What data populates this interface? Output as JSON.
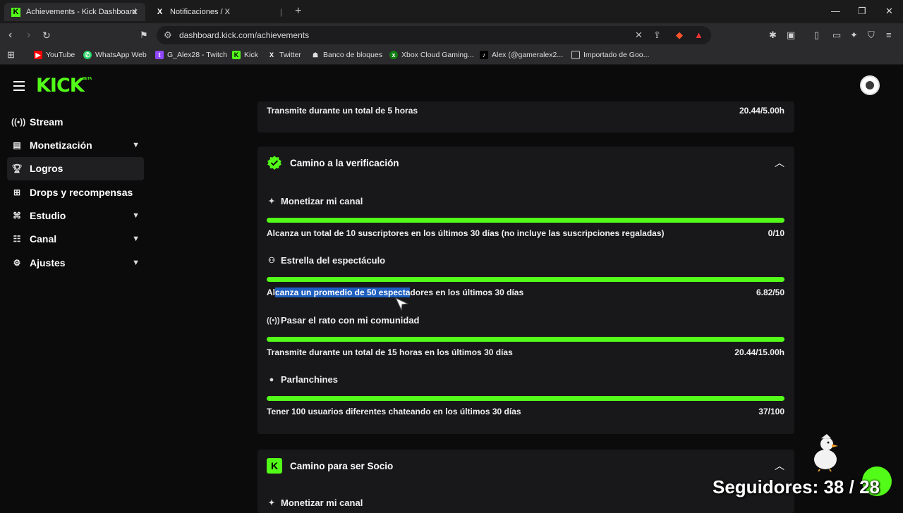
{
  "browser": {
    "tabs": [
      {
        "title": "Achievements - Kick Dashboard",
        "active": true
      },
      {
        "title": "Notificaciones / X",
        "active": false
      }
    ],
    "url": "dashboard.kick.com/achievements",
    "bookmarks": [
      "YouTube",
      "WhatsApp Web",
      "G_Alex28 - Twitch",
      "Kick",
      "Twitter",
      "Banco de bloques",
      "Xbox Cloud Gaming...",
      "Alex (@gameralex2...",
      "Importado de Goo..."
    ]
  },
  "header": {
    "logo": "KICK",
    "logo_badge": "BETA"
  },
  "sidebar": {
    "items": [
      {
        "label": "Stream",
        "icon": "broadcast-icon"
      },
      {
        "label": "Monetización",
        "icon": "chart-icon"
      },
      {
        "label": "Logros",
        "icon": "trophy-icon"
      },
      {
        "label": "Drops y recompensas",
        "icon": "gift-icon"
      },
      {
        "label": "Estudio",
        "icon": "studio-icon"
      },
      {
        "label": "Canal",
        "icon": "channel-icon"
      },
      {
        "label": "Ajustes",
        "icon": "gear-icon"
      }
    ]
  },
  "top_card": {
    "text": "Transmite durante un total de 5 horas",
    "value": "20.44/5.00h"
  },
  "verification": {
    "title": "Camino a la verificación",
    "achievements": [
      {
        "title": "Monetizar mi canal",
        "desc": "Alcanza un total de 10 suscriptores en los últimos 30 días (no incluye las suscripciones regaladas)",
        "value": "0/10",
        "progress": 1.0
      },
      {
        "title": "Estrella del espectáculo",
        "desc_pre": "Al",
        "desc_hl": "canza un promedio de 50 especta",
        "desc_post": "dores en los últimos 30 días",
        "value": "6.82/50",
        "progress": 1.0
      },
      {
        "title": "Pasar el rato con mi comunidad",
        "desc": "Transmite durante un total de 15 horas en los últimos 30 días",
        "value": "20.44/15.00h",
        "progress": 1.0
      },
      {
        "title": "Parlanchines",
        "desc": "Tener 100 usuarios diferentes chateando en los últimos 30 días",
        "value": "37/100",
        "progress": 1.0
      }
    ]
  },
  "socio": {
    "title": "Camino para ser Socio",
    "first_item": "Monetizar mi canal"
  },
  "overlay": {
    "followers_text": "Seguidores: 38 / 28"
  },
  "colors": {
    "accent": "#53fc18",
    "selection": "#1f5fbf"
  }
}
